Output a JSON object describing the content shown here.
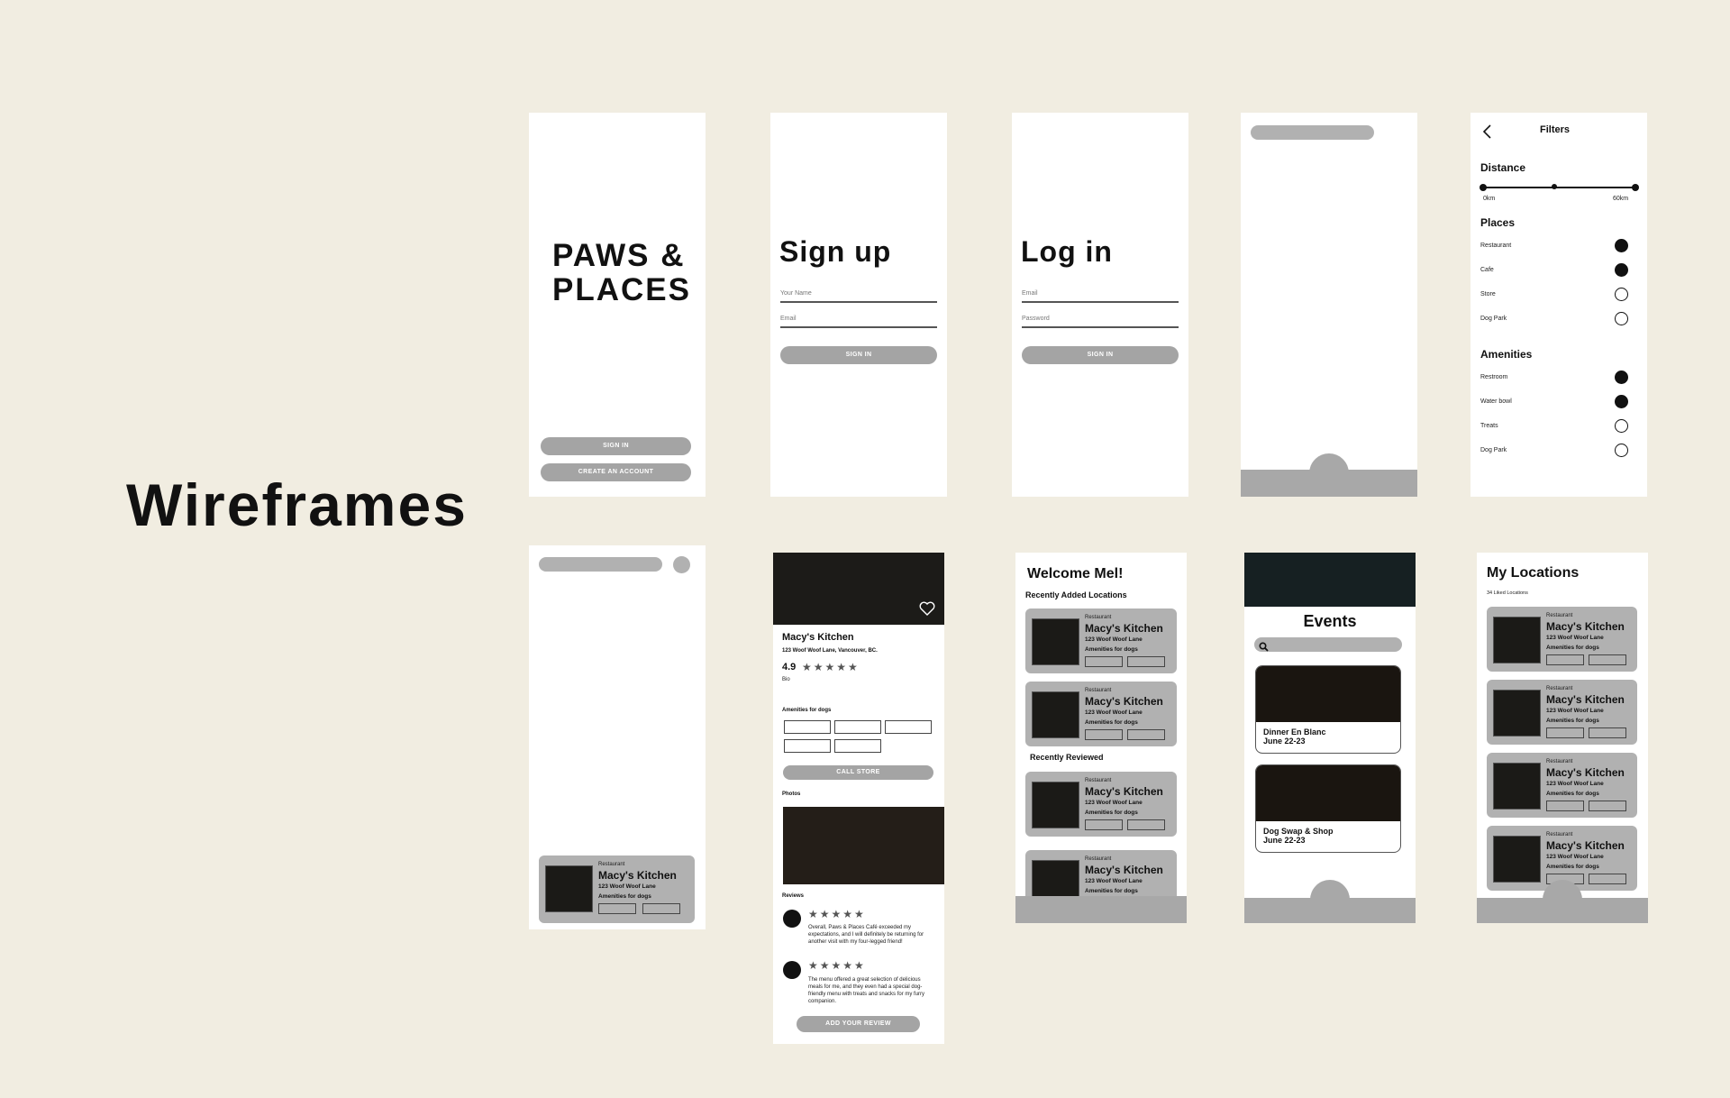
{
  "page": {
    "title": "Wireframes",
    "background": "#f1ede1",
    "accent_gray": "#a4a4a4"
  },
  "splash": {
    "logo_line1": "PAWS &",
    "logo_line2": "PLACES",
    "sign_in": "SIGN IN",
    "create_account": "CREATE AN ACCOUNT"
  },
  "signup": {
    "title": "Sign up",
    "name_placeholder": "Your Name",
    "email_placeholder": "Email",
    "button": "SIGN IN"
  },
  "login": {
    "title": "Log in",
    "email_placeholder": "Email",
    "password_placeholder": "Password",
    "button": "SIGN IN"
  },
  "filters": {
    "title": "Filters",
    "distance_label": "Distance",
    "distance_min": "0km",
    "distance_max": "60km",
    "places_label": "Places",
    "places": [
      {
        "label": "Restaurant",
        "selected": true
      },
      {
        "label": "Cafe",
        "selected": true
      },
      {
        "label": "Store",
        "selected": false
      },
      {
        "label": "Dog Park",
        "selected": false
      }
    ],
    "amenities_label": "Amenities",
    "amenities": [
      {
        "label": "Restroom",
        "selected": true
      },
      {
        "label": "Water bowl",
        "selected": true
      },
      {
        "label": "Treats",
        "selected": false
      },
      {
        "label": "Dog Park",
        "selected": false
      }
    ]
  },
  "card": {
    "type": "Restaurant",
    "name": "Macy's Kitchen",
    "address": "123 Woof Woof Lane",
    "amenities": "Amenities for dogs"
  },
  "detail": {
    "name": "Macy's Kitchen",
    "address": "123 Woof Woof Lane, Vancouver, BC.",
    "rating": "4.9",
    "stars": "★★★★★",
    "bio": "Bio",
    "amenities_title": "Amenities for dogs",
    "call_button": "CALL STORE",
    "photos_title": "Photos",
    "reviews_title": "Reviews",
    "reviews": [
      {
        "stars": "★★★★★",
        "text": "Overall, Paws & Places Café exceeded my expectations, and I will definitely be returning for another visit with my four-legged friend!"
      },
      {
        "stars": "★★★★★",
        "text": "The menu offered a great selection of delicious meals for me, and they even had a special dog-friendly menu with treats and snacks for my furry companion."
      }
    ],
    "add_review": "ADD YOUR REVIEW"
  },
  "home": {
    "welcome": "Welcome Mel!",
    "recent_added": "Recently Added Locations",
    "recent_reviewed": "Recently Reviewed"
  },
  "events": {
    "title": "Events",
    "items": [
      {
        "name": "Dinner En Blanc",
        "date": "June 22-23"
      },
      {
        "name": "Dog Swap & Shop",
        "date": "June 22-23"
      }
    ]
  },
  "my_locations": {
    "title": "My Locations",
    "count": "34 Liked Locations"
  }
}
